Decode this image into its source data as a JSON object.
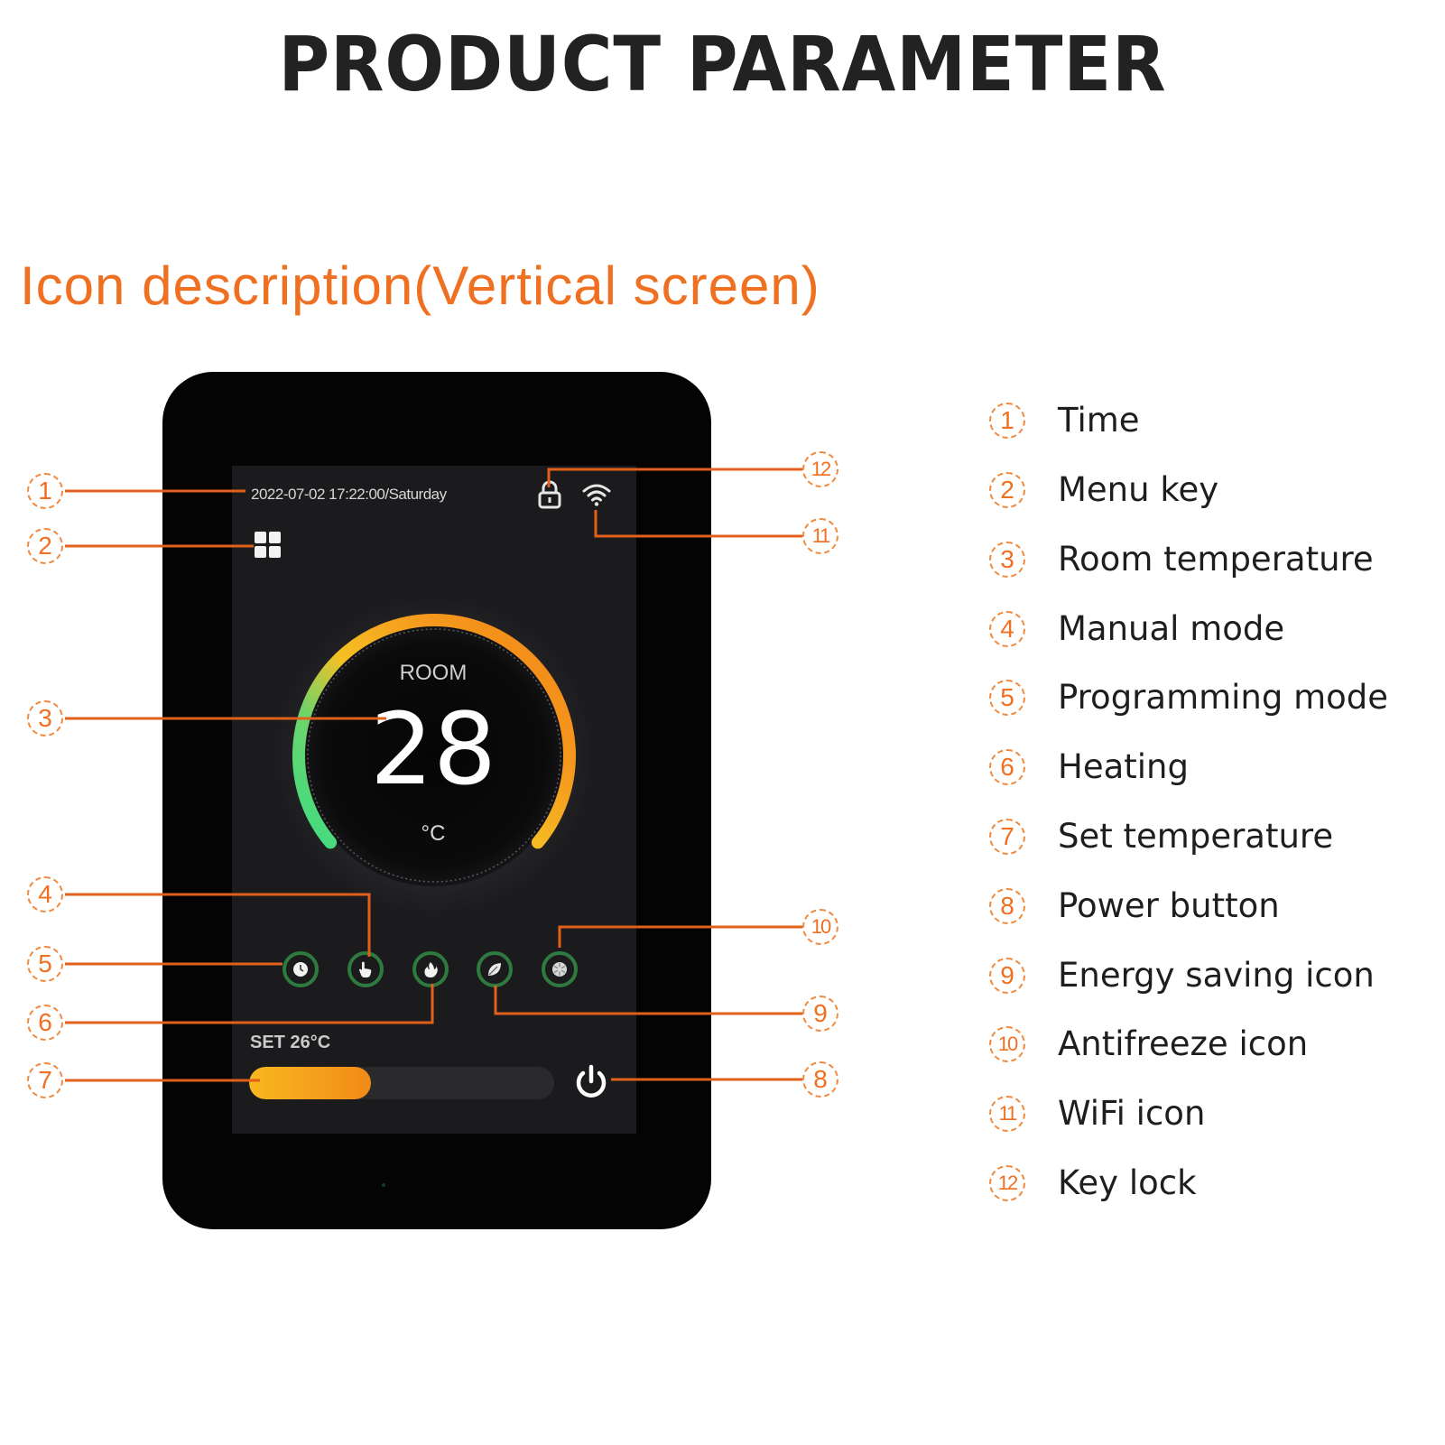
{
  "header": {
    "title": "PRODUCT PARAMETER",
    "subtitle": "Icon description(Vertical screen)"
  },
  "colors": {
    "accent": "#f07022",
    "callout_line": "#e0601c",
    "device_body": "#040404",
    "screen_bg": "#1b1b1d",
    "mode_ring": "#2f7a3e",
    "arc_start": "#3ddc84",
    "arc_mid": "#f5c023",
    "arc_end": "#f28a18"
  },
  "screen": {
    "datetime": "2022-07-02  17:22:00/Saturday",
    "room_label": "ROOM",
    "room_temperature": "28",
    "room_unit": "°C",
    "set_label": "SET 26°C",
    "set_level_fraction": 0.4,
    "dial_arc_fraction": 1.0,
    "icons": {
      "lock": "lock-icon",
      "wifi": "wifi-icon",
      "menu": "grid-menu-icon",
      "power": "power-icon"
    },
    "mode_buttons": [
      {
        "name": "programming-mode",
        "icon": "clock-icon"
      },
      {
        "name": "manual-mode",
        "icon": "hand-icon"
      },
      {
        "name": "heating",
        "icon": "flame-icon"
      },
      {
        "name": "energy-saving",
        "icon": "leaf-icon"
      },
      {
        "name": "antifreeze",
        "icon": "snowflake-icon"
      }
    ]
  },
  "callouts": [
    {
      "num": "1"
    },
    {
      "num": "2"
    },
    {
      "num": "3"
    },
    {
      "num": "4"
    },
    {
      "num": "5"
    },
    {
      "num": "6"
    },
    {
      "num": "7"
    },
    {
      "num": "8"
    },
    {
      "num": "9"
    },
    {
      "num": "10"
    },
    {
      "num": "11"
    },
    {
      "num": "12"
    }
  ],
  "legend": [
    {
      "num": "1",
      "label": "Time"
    },
    {
      "num": "2",
      "label": "Menu key"
    },
    {
      "num": "3",
      "label": "Room temperature"
    },
    {
      "num": "4",
      "label": "Manual mode"
    },
    {
      "num": "5",
      "label": "Programming mode"
    },
    {
      "num": "6",
      "label": "Heating"
    },
    {
      "num": "7",
      "label": "Set temperature"
    },
    {
      "num": "8",
      "label": "Power button"
    },
    {
      "num": "9",
      "label": "Energy saving icon"
    },
    {
      "num": "10",
      "label": "Antifreeze icon"
    },
    {
      "num": "11",
      "label": "WiFi icon"
    },
    {
      "num": "12",
      "label": "Key lock"
    }
  ]
}
